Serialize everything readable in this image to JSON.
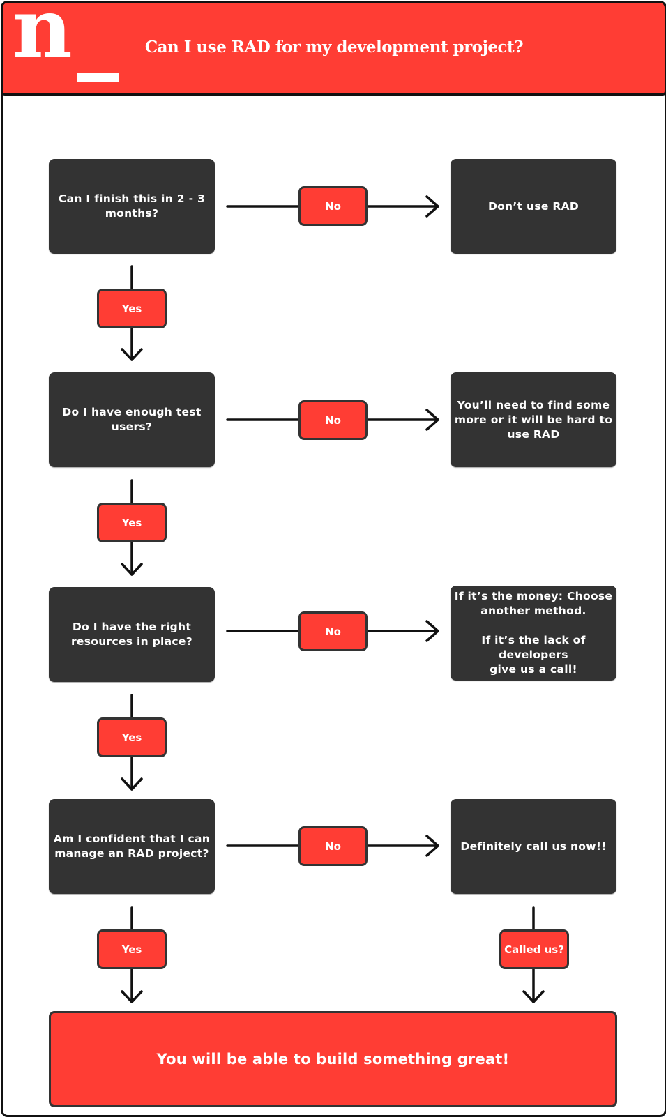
{
  "header": {
    "logo_letter": "n",
    "title": "Can I use RAD for my development project?",
    "background_color": "#ff3d34"
  },
  "colors": {
    "accent_red": "#ff3d34",
    "box_dark": "#333333",
    "connector": "#111111",
    "text_light": "#ffffff"
  },
  "rows": [
    {
      "question": "Can I finish this in 2 - 3\nmonths?",
      "no_label": "No",
      "no_outcome": "Don’t use RAD",
      "yes_label": "Yes"
    },
    {
      "question": "Do I have enough test\nusers?",
      "no_label": "No",
      "no_outcome": "You’ll need to find some\nmore or it will be hard to\nuse RAD",
      "yes_label": "Yes"
    },
    {
      "question": "Do I have the right\nresources in place?",
      "no_label": "No",
      "no_outcome": "If it’s the money: Choose\nanother method.\n\nIf it’s the lack of developers\ngive us a call!",
      "yes_label": "Yes"
    },
    {
      "question": "Am I confident that I can\nmanage an RAD project?",
      "no_label": "No",
      "no_outcome": "Definitely call us now!!",
      "yes_label": "Yes"
    }
  ],
  "called_us_label": "Called us?",
  "final_outcome": "You will be able to build something great!"
}
